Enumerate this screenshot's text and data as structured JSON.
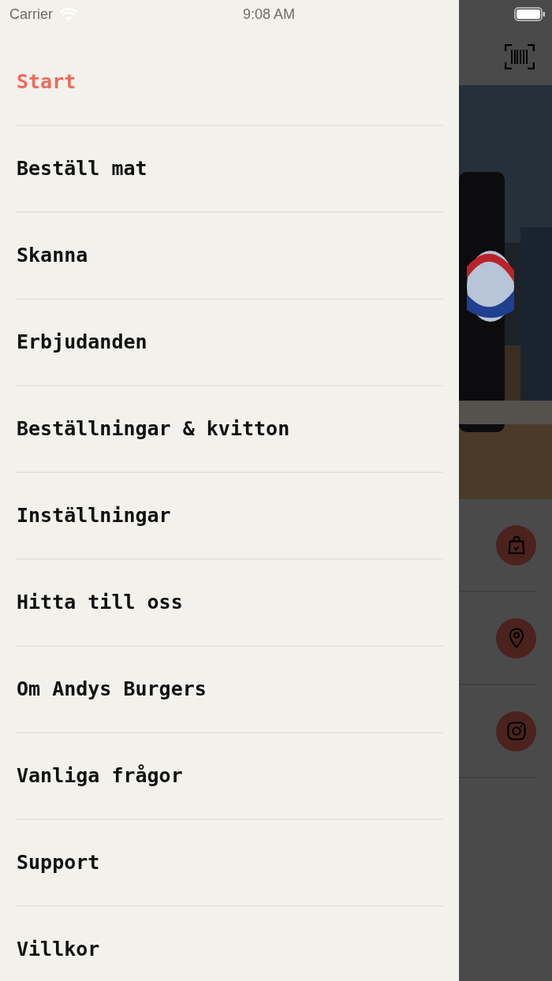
{
  "status_bar": {
    "carrier": "Carrier",
    "time": "9:08 AM"
  },
  "menu": [
    {
      "label": "Start",
      "selected": true
    },
    {
      "label": "Beställ mat",
      "selected": false
    },
    {
      "label": "Skanna",
      "selected": false
    },
    {
      "label": "Erbjudanden",
      "selected": false
    },
    {
      "label": "Beställningar & kvitton",
      "selected": false
    },
    {
      "label": "Inställningar",
      "selected": false
    },
    {
      "label": "Hitta till oss",
      "selected": false
    },
    {
      "label": "Om Andys Burgers",
      "selected": false
    },
    {
      "label": "Vanliga frågor",
      "selected": false
    },
    {
      "label": "Support",
      "selected": false
    },
    {
      "label": "Villkor",
      "selected": false
    }
  ],
  "background_actions": [
    {
      "kind": "bag"
    },
    {
      "kind": "pin"
    },
    {
      "kind": "camera"
    }
  ]
}
